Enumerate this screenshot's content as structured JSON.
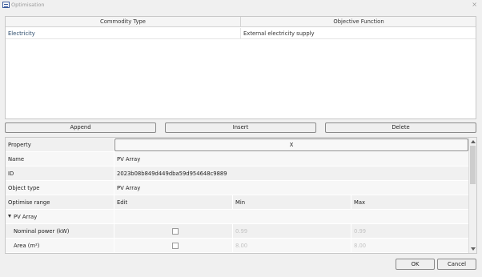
{
  "window": {
    "title": "Optimisation",
    "close_glyph": "×"
  },
  "commodity_table": {
    "headers": [
      "Commodity Type",
      "Objective Function"
    ],
    "rows": [
      {
        "commodity": "Electricity",
        "objective": "External electricity supply"
      }
    ]
  },
  "buttons": {
    "append": "Append",
    "insert": "Insert",
    "delete": "Delete",
    "ok": "OK",
    "cancel": "Cancel"
  },
  "property_grid": {
    "header_label": "Property",
    "header_button": "X",
    "name_label": "Name",
    "name_value": "PV Array",
    "id_label": "ID",
    "id_value": "2023b08b849d449dba59d954648c9889",
    "type_label": "Object type",
    "type_value": "PV Array",
    "range_label": "Optimise range",
    "edit_label": "Edit",
    "min_label": "Min",
    "max_label": "Max",
    "group_label": "PV Array",
    "params": [
      {
        "label": "Nominal power (kW)",
        "edit": false,
        "min": "0.99",
        "max": "0.99"
      },
      {
        "label": "Area (m²)",
        "edit": false,
        "min": "8.00",
        "max": "8.00"
      }
    ]
  },
  "icons": {
    "app": "app-window-icon",
    "expand": "triangle-down-icon"
  },
  "colors": {
    "background": "#f0f0f0",
    "grid_row_odd": "#f0f0f0",
    "grid_row_even": "#f7f7f7",
    "link_text": "#2a4a6a",
    "disabled_text": "#c4c4c4"
  }
}
